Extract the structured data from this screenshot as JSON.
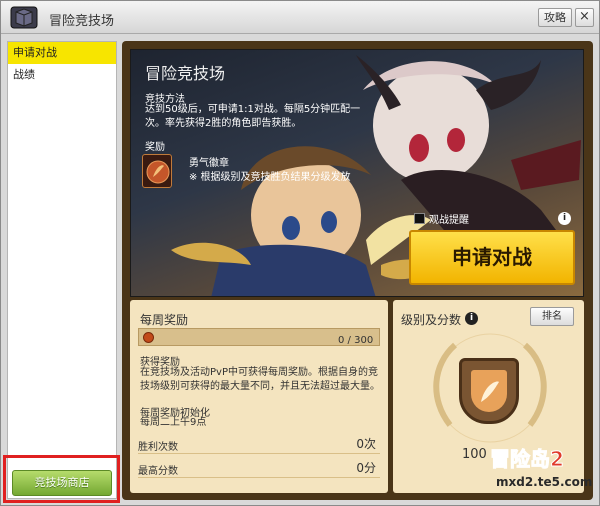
{
  "window": {
    "title": "冒险竞技场",
    "guide_label": "攻略",
    "close_symbol": "×"
  },
  "sidebar": {
    "items": [
      {
        "label": "申请对战",
        "active": true
      },
      {
        "label": "战绩",
        "active": false
      }
    ],
    "shop_button": "竞技场商店"
  },
  "banner": {
    "title": "冒险竞技场",
    "method_title": "竞技方法",
    "method_text": "达到50级后，可申请1:1对战。每隔5分钟匹配一次。率先获得2胜的角色即告获胜。",
    "reward_title": "奖励",
    "medal_name": "勇气徽章",
    "medal_desc": "※ 根据级别及竞技胜负结果分级发放",
    "spectate_label": "观战提醒",
    "apply_button": "申请对战"
  },
  "weekly": {
    "title": "每周奖励",
    "progress_text": "0 / 300",
    "progress_fraction": 0,
    "obtain_title": "获得奖励",
    "obtain_text": "在竞技场及活动PvP中可获得每周奖励。根据自身的竞技场级别可获得的最大量不同，并且无法超过最大量。",
    "reset_title": "每周奖励初始化",
    "reset_text": "每周二上午9点",
    "wins_label": "胜利次数",
    "wins_value": "0次",
    "best_label": "最高分数",
    "best_value": "0分"
  },
  "rank": {
    "title": "级别及分数",
    "rank_button": "排名",
    "score": "100"
  },
  "watermark": {
    "logo_text": "冒险岛2",
    "site_text": "mxd2.te5.com"
  },
  "colors": {
    "active_tab": "#f7e500",
    "apply_button": "#f2b400",
    "shop_button": "#74a832",
    "panel_bg": "#f4e4bf",
    "highlight_box": "#e02020"
  }
}
